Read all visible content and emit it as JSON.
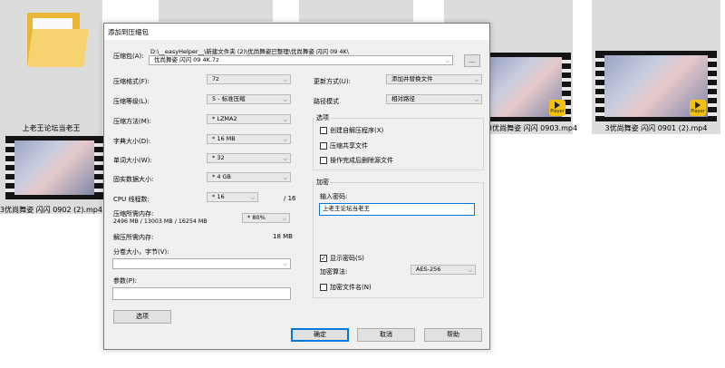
{
  "desktop": {
    "files": [
      {
        "label": "上老王论坛当老王"
      },
      {
        "label": "3优尚舞姿 闪闪 0902 (2).mp4"
      },
      {
        "label": "3优尚舞姿 闪闪 0903.mp4"
      },
      {
        "label": "3优尚舞姿 闪闪 0901 (2).mp4"
      }
    ],
    "player_badge": "Player"
  },
  "dialog": {
    "title": "添加到压缩包",
    "archive": {
      "label": "压缩包(A):",
      "path": "D:\\__easyHelper__\\新建文件夹 (2)\\优尚舞姿已整理\\优尚舞姿 闪闪 09 4K\\",
      "name": "优尚舞姿 闪闪 09 4K.7z",
      "browse_label": "..."
    },
    "left": {
      "format": {
        "label": "压缩格式(F):",
        "value": "7z"
      },
      "level": {
        "label": "压缩等级(L):",
        "value": "5 - 标准压缩"
      },
      "method": {
        "label": "压缩方法(M):",
        "value": "* LZMA2"
      },
      "dict": {
        "label": "字典大小(D):",
        "value": "* 16 MB"
      },
      "word": {
        "label": "单词大小(W):",
        "value": "* 32"
      },
      "solid": {
        "label": "固实数据大小:",
        "value": "* 4 GB"
      },
      "threads": {
        "label": "CPU 线程数:",
        "value": "* 16",
        "max": "/ 16"
      },
      "mem_compress": {
        "label": "压缩所需内存:",
        "detail": "2496 MB / 13003 MB / 16254 MB",
        "value": "* 80%"
      },
      "mem_decompress": {
        "label": "解压所需内存:",
        "value": "18 MB"
      },
      "split": {
        "label": "分卷大小，字节(V):",
        "value": ""
      },
      "params": {
        "label": "参数(P):",
        "value": ""
      },
      "options_button": "选项"
    },
    "right": {
      "update": {
        "label": "更新方式(U):",
        "value": "添加并替换文件"
      },
      "path_mode": {
        "label": "路径模式",
        "value": "相对路径"
      },
      "options": {
        "title": "选项",
        "sfx": {
          "label": "创建自解压程序(X)",
          "checked": false
        },
        "shared": {
          "label": "压缩共享文件",
          "checked": false
        },
        "delete": {
          "label": "操作完成后删除源文件",
          "checked": false
        }
      },
      "encryption": {
        "title": "加密",
        "password_label": "输入密码:",
        "password_value": "上老王论坛当老王",
        "show_password": {
          "label": "显示密码(S)",
          "checked": true
        },
        "method_label": "加密算法:",
        "method_value": "AES-256",
        "encrypt_names": {
          "label": "加密文件名(N)",
          "checked": false
        }
      }
    },
    "buttons": {
      "ok": "确定",
      "cancel": "取消",
      "help": "帮助"
    }
  }
}
